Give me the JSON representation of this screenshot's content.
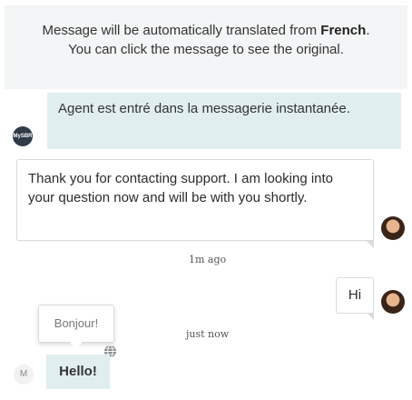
{
  "notice": {
    "before": "Message will be automatically translated from ",
    "language": "French",
    "after": ". You can click the message to see the original."
  },
  "messages": {
    "agent_avatar_text": "MySBR",
    "agent_system": "Agent est entré dans la messagerie instantanée.",
    "support": "Thank you for contacting support. I am looking into your question now and will be with you shortly.",
    "timestamp_1": "1m ago",
    "customer_hi": "Hi",
    "timestamp_2": "just now",
    "tooltip_original": "Bonjour!",
    "user_avatar_initial": "M",
    "user_hello": "Hello!"
  },
  "colors": {
    "agent_bubble": "#e1eef0",
    "notice_bg": "#f4f5f6",
    "bubble_border": "#d8dcdf"
  }
}
